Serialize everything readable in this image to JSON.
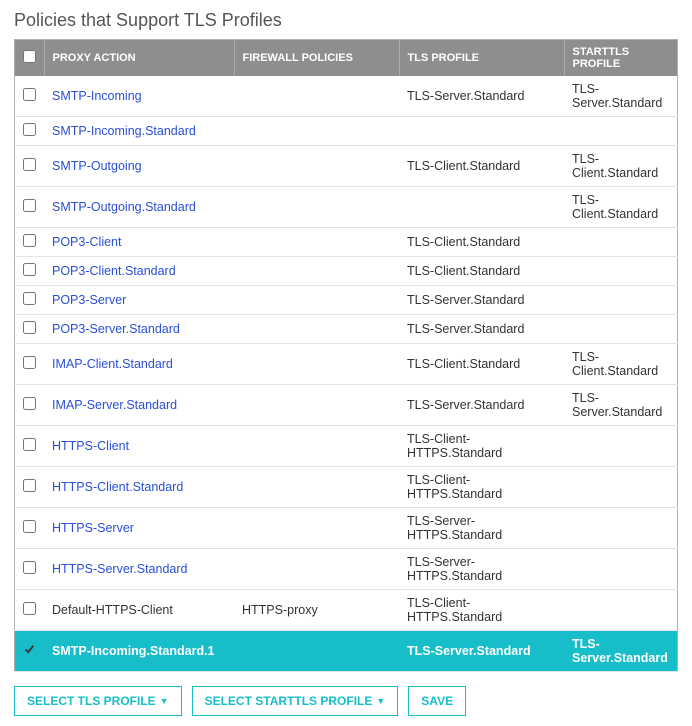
{
  "title": "Policies that Support TLS Profiles",
  "columns": {
    "proxy": "PROXY ACTION",
    "firewall": "FIREWALL POLICIES",
    "tls": "TLS PROFILE",
    "starttls": "STARTTLS PROFILE"
  },
  "rows": [
    {
      "checked": false,
      "link": true,
      "proxy": "SMTP-Incoming",
      "firewall": "",
      "tls": "TLS-Server.Standard",
      "starttls": "TLS-Server.Standard",
      "selected": false
    },
    {
      "checked": false,
      "link": true,
      "proxy": "SMTP-Incoming.Standard",
      "firewall": "",
      "tls": "",
      "starttls": "",
      "selected": false
    },
    {
      "checked": false,
      "link": true,
      "proxy": "SMTP-Outgoing",
      "firewall": "",
      "tls": "TLS-Client.Standard",
      "starttls": "TLS-Client.Standard",
      "selected": false
    },
    {
      "checked": false,
      "link": true,
      "proxy": "SMTP-Outgoing.Standard",
      "firewall": "",
      "tls": "",
      "starttls": "TLS-Client.Standard",
      "selected": false
    },
    {
      "checked": false,
      "link": true,
      "proxy": "POP3-Client",
      "firewall": "",
      "tls": "TLS-Client.Standard",
      "starttls": "",
      "selected": false
    },
    {
      "checked": false,
      "link": true,
      "proxy": "POP3-Client.Standard",
      "firewall": "",
      "tls": "TLS-Client.Standard",
      "starttls": "",
      "selected": false
    },
    {
      "checked": false,
      "link": true,
      "proxy": "POP3-Server",
      "firewall": "",
      "tls": "TLS-Server.Standard",
      "starttls": "",
      "selected": false
    },
    {
      "checked": false,
      "link": true,
      "proxy": "POP3-Server.Standard",
      "firewall": "",
      "tls": "TLS-Server.Standard",
      "starttls": "",
      "selected": false
    },
    {
      "checked": false,
      "link": true,
      "proxy": "IMAP-Client.Standard",
      "firewall": "",
      "tls": "TLS-Client.Standard",
      "starttls": "TLS-Client.Standard",
      "selected": false
    },
    {
      "checked": false,
      "link": true,
      "proxy": "IMAP-Server.Standard",
      "firewall": "",
      "tls": "TLS-Server.Standard",
      "starttls": "TLS-Server.Standard",
      "selected": false
    },
    {
      "checked": false,
      "link": true,
      "proxy": "HTTPS-Client",
      "firewall": "",
      "tls": "TLS-Client-HTTPS.Standard",
      "starttls": "",
      "selected": false
    },
    {
      "checked": false,
      "link": true,
      "proxy": "HTTPS-Client.Standard",
      "firewall": "",
      "tls": "TLS-Client-HTTPS.Standard",
      "starttls": "",
      "selected": false
    },
    {
      "checked": false,
      "link": true,
      "proxy": "HTTPS-Server",
      "firewall": "",
      "tls": "TLS-Server-HTTPS.Standard",
      "starttls": "",
      "selected": false
    },
    {
      "checked": false,
      "link": true,
      "proxy": "HTTPS-Server.Standard",
      "firewall": "",
      "tls": "TLS-Server-HTTPS.Standard",
      "starttls": "",
      "selected": false
    },
    {
      "checked": false,
      "link": false,
      "proxy": "Default-HTTPS-Client",
      "firewall": "HTTPS-proxy",
      "tls": "TLS-Client-HTTPS.Standard",
      "starttls": "",
      "selected": false
    },
    {
      "checked": true,
      "link": true,
      "proxy": "SMTP-Incoming.Standard.1",
      "firewall": "",
      "tls": "TLS-Server.Standard",
      "starttls": "TLS-Server.Standard",
      "selected": true
    }
  ],
  "buttons": {
    "select_tls": "SELECT TLS PROFILE",
    "select_starttls": "SELECT STARTTLS PROFILE",
    "save": "SAVE"
  }
}
